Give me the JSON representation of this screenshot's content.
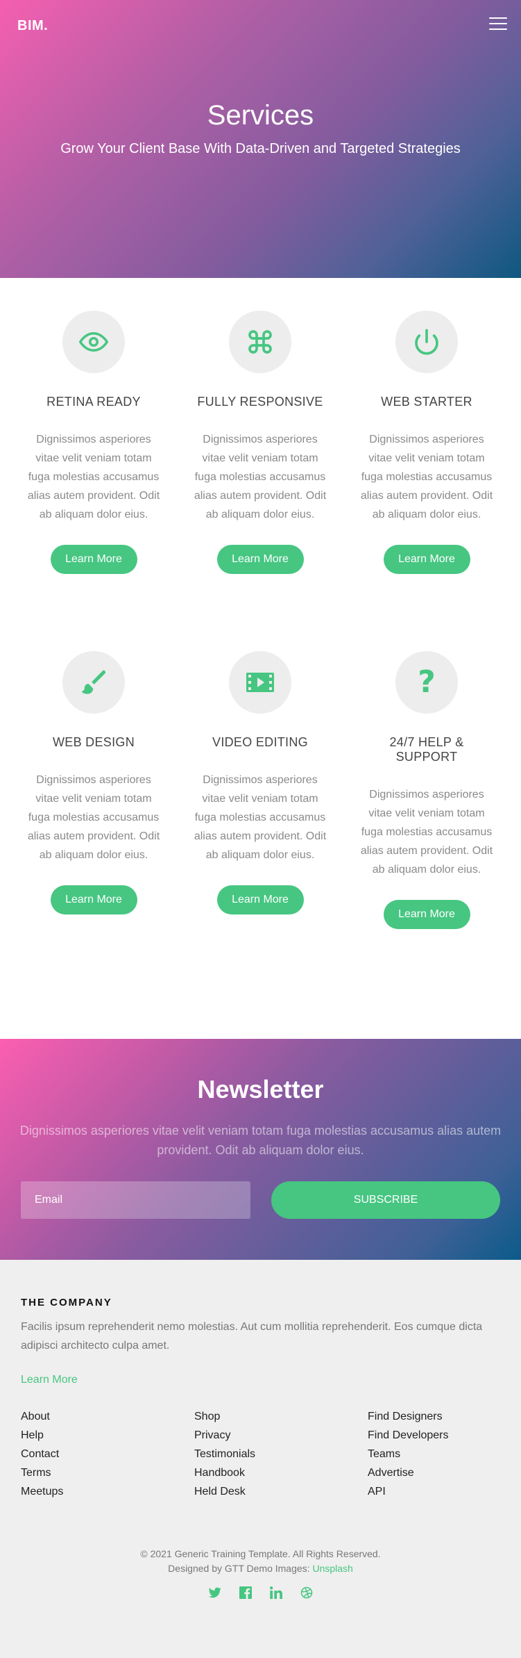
{
  "header": {
    "logo": "BIM.",
    "menu_icon": "hamburger-menu-icon"
  },
  "hero": {
    "title": "Services",
    "subtitle": "Grow Your Client Base With Data-Driven and Targeted Strategies"
  },
  "services": [
    {
      "icon": "eye-icon",
      "title": "Retina Ready",
      "text": "Dignissimos asperiores vitae velit veniam totam fuga molestias accusamus alias autem provident. Odit ab aliquam dolor eius.",
      "button": "Learn More"
    },
    {
      "icon": "command-icon",
      "title": "Fully Responsive",
      "text": "Dignissimos asperiores vitae velit veniam totam fuga molestias accusamus alias autem provident. Odit ab aliquam dolor eius.",
      "button": "Learn More"
    },
    {
      "icon": "power-icon",
      "title": "Web Starter",
      "text": "Dignissimos asperiores vitae velit veniam totam fuga molestias accusamus alias autem provident. Odit ab aliquam dolor eius.",
      "button": "Learn More"
    },
    {
      "icon": "paint-brush-icon",
      "title": "Web Design",
      "text": "Dignissimos asperiores vitae velit veniam totam fuga molestias accusamus alias autem provident. Odit ab aliquam dolor eius.",
      "button": "Learn More"
    },
    {
      "icon": "film-icon",
      "title": "Video Editing",
      "text": "Dignissimos asperiores vitae velit veniam totam fuga molestias accusamus alias autem provident. Odit ab aliquam dolor eius.",
      "button": "Learn More"
    },
    {
      "icon": "question-icon",
      "title": "24/7 Help & Support",
      "text": "Dignissimos asperiores vitae velit veniam totam fuga molestias accusamus alias autem provident. Odit ab aliquam dolor eius.",
      "button": "Learn More"
    }
  ],
  "newsletter": {
    "title": "Newsletter",
    "text": "Dignissimos asperiores vitae velit veniam totam fuga molestias accusamus alias autem provident. Odit ab aliquam dolor eius.",
    "email_placeholder": "Email",
    "subscribe_label": "Subscribe"
  },
  "footer": {
    "company_heading": "THE COMPANY",
    "description": "Facilis ipsum reprehenderit nemo molestias. Aut cum mollitia reprehenderit. Eos cumque dicta adipisci architecto culpa amet.",
    "learn_more": "Learn More",
    "columns": [
      [
        "About",
        "Help",
        "Contact",
        "Terms",
        "Meetups"
      ],
      [
        "Shop",
        "Privacy",
        "Testimonials",
        "Handbook",
        "Held Desk"
      ],
      [
        "Find Designers",
        "Find Developers",
        "Teams",
        "Advertise",
        "API"
      ]
    ],
    "copyright": "© 2021 Generic Training Template. All Rights Reserved.",
    "credit_prefix": "Designed by GTT Demo Images: ",
    "credit_link": "Unsplash",
    "social_icons": [
      "twitter-icon",
      "facebook-icon",
      "linkedin-icon",
      "dribbble-icon"
    ]
  },
  "colors": {
    "accent": "#46c681",
    "hero_gradient_start": "#f55fb0",
    "hero_gradient_end": "#0e5880",
    "footer_bg": "#efefef"
  }
}
